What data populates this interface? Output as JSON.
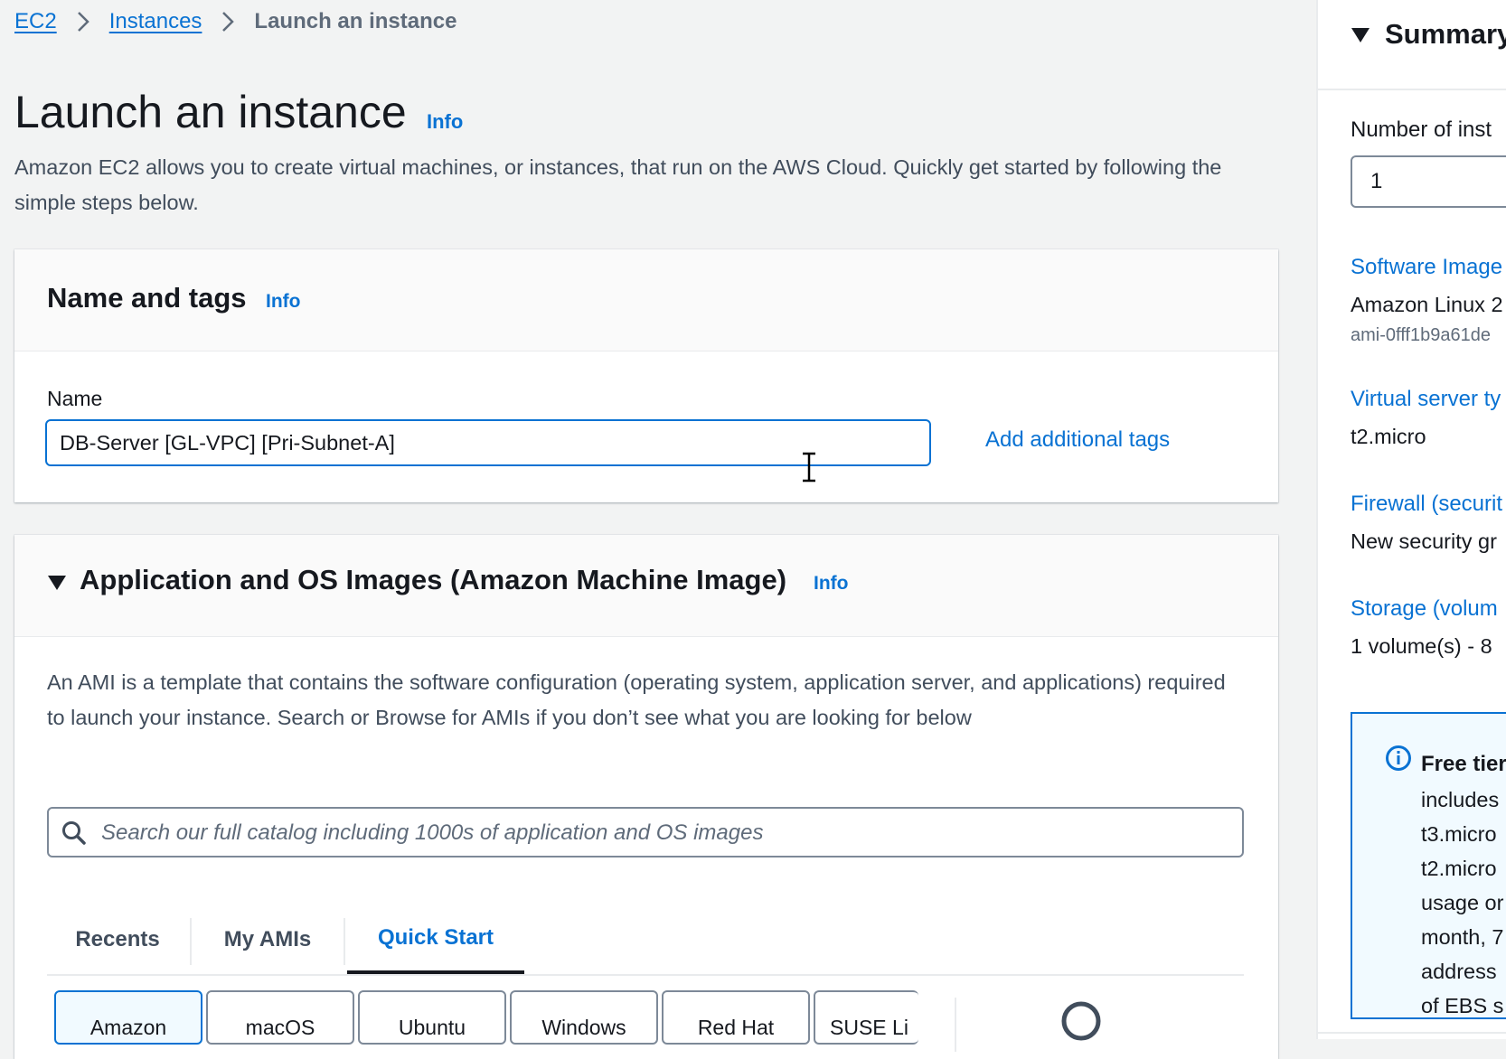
{
  "breadcrumb": {
    "items": [
      "EC2",
      "Instances"
    ],
    "current": "Launch an instance"
  },
  "page": {
    "title": "Launch an instance",
    "info_link": "Info",
    "description": "Amazon EC2 allows you to create virtual machines, or instances, that run on the AWS Cloud. Quickly get started by following the simple steps below."
  },
  "name_tags": {
    "title": "Name and tags",
    "info_link": "Info",
    "name_label": "Name",
    "name_value": "DB-Server [GL-VPC] [Pri-Subnet-A]",
    "add_tags_link": "Add additional tags"
  },
  "ami": {
    "title": "Application and OS Images (Amazon Machine Image)",
    "info_link": "Info",
    "description": "An AMI is a template that contains the software configuration (operating system, application server, and applications) required to launch your instance. Search or Browse for AMIs if you don’t see what you are looking for below",
    "search_placeholder": "Search our full catalog including 1000s of application and OS images",
    "tabs": [
      "Recents",
      "My AMIs",
      "Quick Start"
    ],
    "active_tab": "Quick Start",
    "os_options": [
      "Amazon",
      "macOS",
      "Ubuntu",
      "Windows",
      "Red Hat",
      "SUSE Li"
    ]
  },
  "summary": {
    "title": "Summary",
    "instances_label": "Number of inst",
    "instances_value": "1",
    "software_image_link": "Software Image",
    "software_image_value": "Amazon Linux 2",
    "software_image_id": "ami-0fff1b9a61de",
    "server_type_link": "Virtual server ty",
    "server_type_value": "t2.micro",
    "firewall_link": "Firewall (securit",
    "firewall_value": "New security gr",
    "storage_link": "Storage (volum",
    "storage_value": "1 volume(s) - 8",
    "free_tier": {
      "title": "Free tier",
      "lines": [
        "includes",
        "t3.micro",
        "t2.micro",
        "usage or",
        "month, 7",
        "address",
        "of EBS s"
      ]
    }
  },
  "colors": {
    "link": "#0972d3",
    "page_bg": "#f2f3f3",
    "text": "#16191f",
    "info_box_bg": "#f1faff"
  }
}
